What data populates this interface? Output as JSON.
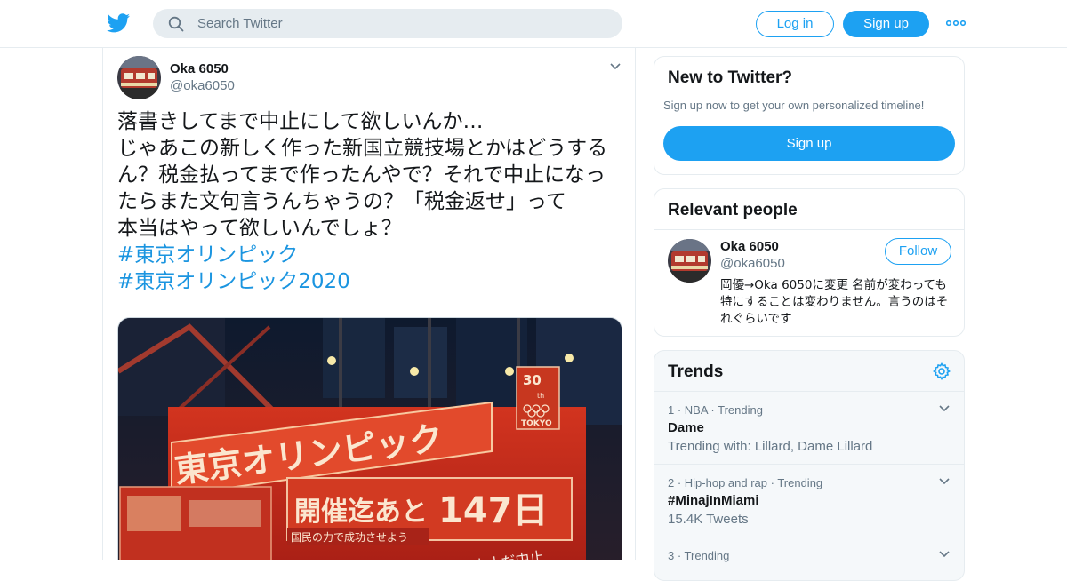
{
  "header": {
    "search_placeholder": "Search Twitter",
    "login_label": "Log in",
    "signup_label": "Sign up"
  },
  "tweet": {
    "author_name": "Oka 6050",
    "author_handle": "@oka6050",
    "lines": [
      "落書きしてまで中止にして欲しいんか…",
      "じゃあこの新しく作った新国立競技場とかはどうする",
      "ん？税金払ってまで作ったんやで？それで中止になっ",
      "たらまた文句言うんちゃうの？「税金返せ」って",
      "本当はやって欲しいんでしょ？"
    ],
    "hashtags": [
      "#東京オリンピック",
      "#東京オリンピック2020"
    ],
    "media": {
      "sign_main": "東京オリンピック",
      "sign_sub": "開催迄あと",
      "sign_days": "147日",
      "sign_bottom": "国民の力で成功させよう",
      "badge_num": "30",
      "badge_th": "th",
      "badge_city": "TOKYO",
      "graffiti": "中止だ中止"
    }
  },
  "sidebar": {
    "new_to_twitter": {
      "title": "New to Twitter?",
      "subtitle": "Sign up now to get your own personalized timeline!",
      "signup_label": "Sign up"
    },
    "relevant_people": {
      "title": "Relevant people",
      "name": "Oka 6050",
      "handle": "@oka6050",
      "follow_label": "Follow",
      "bio": "岡優→Oka 6050に変更 名前が変わっても特にすることは変わりません。言うのはそれぐらいです"
    },
    "trends": {
      "title": "Trends",
      "items": [
        {
          "meta": "1 · NBA · Trending",
          "name": "Dame",
          "context": "Trending with: Lillard, Dame Lillard"
        },
        {
          "meta": "2 · Hip-hop and rap · Trending",
          "name": "#MinajInMiami",
          "context": "15.4K Tweets"
        },
        {
          "meta": "3 · Trending",
          "name": "",
          "context": ""
        }
      ]
    }
  },
  "colors": {
    "brand_blue": "#1da1f2",
    "hashtag_blue": "#1b95e0",
    "muted_text": "#657786",
    "border": "#e6ecf0",
    "sign_red": "#c4281d"
  }
}
